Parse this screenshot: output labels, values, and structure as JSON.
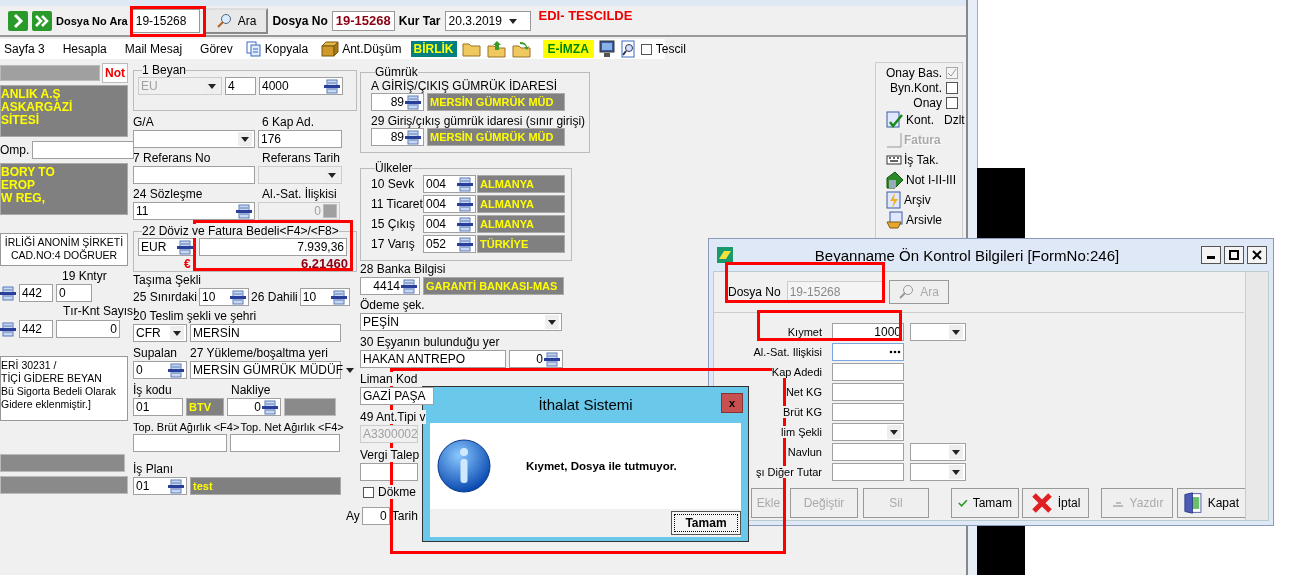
{
  "top_bar": {
    "search_label": "Dosya No Ara",
    "search_value": "19-15268",
    "search_button": "Ara",
    "file_label": "Dosya No",
    "file_value": "19-15268",
    "rate_date_label": "Kur Tar",
    "rate_date": "20.3.2019",
    "status": "EDI- TESCILDE"
  },
  "toolbar": {
    "items": [
      {
        "kind": "text",
        "label": "Sayfa 3"
      },
      {
        "kind": "text",
        "label": "Hesapla"
      },
      {
        "kind": "text",
        "label": "Mail Mesaj"
      },
      {
        "kind": "text",
        "label": "Görev"
      },
      {
        "kind": "copy",
        "label": "Kopyala"
      },
      {
        "kind": "box",
        "label": "Ant.Düşüm"
      },
      {
        "kind": "birlik",
        "label": "BİRLİK"
      },
      {
        "kind": "folder"
      },
      {
        "kind": "folder-up"
      },
      {
        "kind": "folder-arrow"
      },
      {
        "kind": "eimza",
        "label": "E-İMZA"
      },
      {
        "kind": "monitor"
      },
      {
        "kind": "preview"
      }
    ],
    "tescil": {
      "label": "Tescil",
      "checked": false
    }
  },
  "party": {
    "not_button": "Not",
    "consignor": "ANLIK A.Ş\nASKARGAZİ\nSİTESİ",
    "comp_label": "Omp.",
    "consignee": "BORY TO\nEROP\nW REG,",
    "declarant": "İRLİĞİ ANONİM ŞİRKETİ\nCAD.NO:4 DOĞRUER",
    "containers_label": "19 Kntyr",
    "containers_code": "442",
    "containers": "0",
    "trucks_label": "Tır-Knt Sayısı",
    "trucks_code": "442",
    "trucks": "0",
    "note": "ERİ 30231 /\nTİÇİ GİDERE BEYAN\nBü Sigorta Bedeli Olarak\nGidere eklenmiştir.]"
  },
  "declaration": {
    "beyan_label": "1 Beyan",
    "beyan_type": {
      "value": "EU",
      "disabled": true
    },
    "beyan_no": "4",
    "beyan_code": "4000",
    "ga_label": "G/A",
    "packages_label": "6 Kap Ad.",
    "packages": "176",
    "reference_label": "7 Referans No",
    "reference_date_label": "Referans Tarih",
    "reference_date": {
      "disabled": true
    },
    "contract_label": "24 Sözleşme",
    "contract": "11",
    "relation_label": "Al.-Sat. İlişkisi",
    "relation": {
      "value": "0",
      "disabled": true
    },
    "invoice_label": "22 Döviz ve Fatura Bedeli<F4>/<F8>",
    "currency": "EUR",
    "currency_symbol": "€",
    "invoice_amount": "7.939,36",
    "exchange_rate": "6,21460",
    "transport_label": "Taşıma Şekli",
    "border_label": "25 Sınırdaki",
    "border": "10",
    "inland_label": "26 Dahili",
    "inland": "10",
    "delivery_label": "20 Teslim şekli ve şehri",
    "delivery_terms": "CFR",
    "delivery_city": "MERSİN",
    "supalan_label": "Supalan",
    "supalan": "0",
    "loading_label": "27 Yükleme/boşaltma yeri",
    "loading_place": "MERSİN GÜMRÜK MÜDÜF",
    "job_code_label": "İş kodu",
    "job_code": "01",
    "job_code_name": "BTV",
    "freight_label": "Nakliye",
    "freight": "0",
    "gross_label": "Top. Brüt Ağırlık <F4>",
    "net_label": "Top. Net Ağırlık <F4>",
    "plan_label": "İş Planı",
    "plan_code": "01",
    "plan_name": "test"
  },
  "customs": {
    "label": "Gümrük",
    "entry_label": "A GİRİŞ/ÇIKIŞ GÜMRÜK İDARESİ",
    "entry_code": "89",
    "entry_name": "MERSİN GÜMRÜK MÜD",
    "border_label": "29 Giriş/çıkış gümrük idaresi (sınır girişi)",
    "border_code": "89",
    "border_name": "MERSİN GÜMRÜK MÜD"
  },
  "countries": {
    "label": "Ülkeler",
    "rows": [
      {
        "label": "10 Sevk",
        "code": "004",
        "name": "ALMANYA"
      },
      {
        "label": "11 Ticaret",
        "code": "004",
        "name": "ALMANYA"
      },
      {
        "label": "15 Çıkış",
        "code": "004",
        "name": "ALMANYA"
      },
      {
        "label": "17 Varış",
        "code": "052",
        "name": "TÜRKİYE"
      }
    ]
  },
  "misc": {
    "bank_label": "28 Banka Bilgisi",
    "bank_code": "4414",
    "bank_name": "GARANTİ BANKASI-MAS",
    "payment_label": "Ödeme şek.",
    "payment": "PEŞİN",
    "location_label": "30 Eşyanın bulunduğu yer",
    "location": "HAKAN ANTREPO",
    "location_code": "0",
    "port_label": "Liman Kod",
    "port": "GAZİ PAŞA",
    "ant_label": "49 Ant.Tipi v",
    "ant": {
      "value": "A3300002",
      "disabled": true
    },
    "tax_label": "Vergi Talep",
    "bulk": {
      "label": "Dökme",
      "checked": false
    },
    "month_label": "Ay",
    "month": "0",
    "date_label": "Tarih"
  },
  "side_panel": {
    "checks": [
      {
        "label": "Onay Bas.",
        "checked": true,
        "disabled": true
      },
      {
        "label": "Byn.Kont.",
        "checked": false,
        "disabled": false
      },
      {
        "label": "Onay",
        "checked": false,
        "disabled": false
      }
    ],
    "actions": [
      {
        "kind": "check-doc",
        "label": "Kont.",
        "extra": "Dzlt",
        "disabled": false
      },
      {
        "kind": "blank",
        "label": "Fatura",
        "disabled": true
      },
      {
        "kind": "keyboard",
        "label": "İş Tak.",
        "disabled": false
      },
      {
        "kind": "book",
        "label": "Not I-II-III",
        "disabled": false
      },
      {
        "kind": "lightning",
        "label": "Arşiv",
        "disabled": false
      },
      {
        "kind": "archive",
        "label": "Arsivle",
        "disabled": false
      }
    ]
  },
  "dialog": {
    "title": "Beyanname Ön Kontrol Bilgileri [FormNo:246]",
    "file_label": "Dosya No",
    "file_value": "19-15268",
    "search_button": "Ara",
    "fields": [
      {
        "kind": "amount",
        "label": "Kıymet",
        "value": "1000"
      },
      {
        "kind": "ellipsis",
        "label": "Al.-Sat. Ilişkisi"
      },
      {
        "kind": "text",
        "label": "Kap Adedi"
      },
      {
        "kind": "text",
        "label": "Net KG"
      },
      {
        "kind": "text",
        "label": "Brüt KG"
      },
      {
        "kind": "select",
        "label": "lim Şekli"
      },
      {
        "kind": "amount",
        "label": "Navlun"
      },
      {
        "kind": "amount",
        "label": "şı Diğer Tutar"
      }
    ],
    "buttons": [
      {
        "kind": "none",
        "label": "Ekle",
        "disabled": true
      },
      {
        "kind": "none",
        "label": "Değiştir",
        "disabled": true
      },
      {
        "kind": "none",
        "label": "Sil",
        "disabled": true
      },
      {
        "kind": "check",
        "label": "Tamam",
        "disabled": false
      },
      {
        "kind": "cross",
        "label": "İptal",
        "disabled": false
      },
      {
        "kind": "print",
        "label": "Yazdır",
        "disabled": true
      },
      {
        "kind": "door",
        "label": "Kapat",
        "disabled": false
      }
    ]
  },
  "message_box": {
    "title": "İthalat Sistemi",
    "close": "x",
    "message": "Kıymet, Dosya ile tutmuyor.",
    "button": "Tamam"
  },
  "highlights": [
    {
      "kind": "box"
    },
    {
      "kind": "box"
    },
    {
      "kind": "box"
    },
    {
      "kind": "box"
    },
    {
      "kind": "box"
    }
  ]
}
